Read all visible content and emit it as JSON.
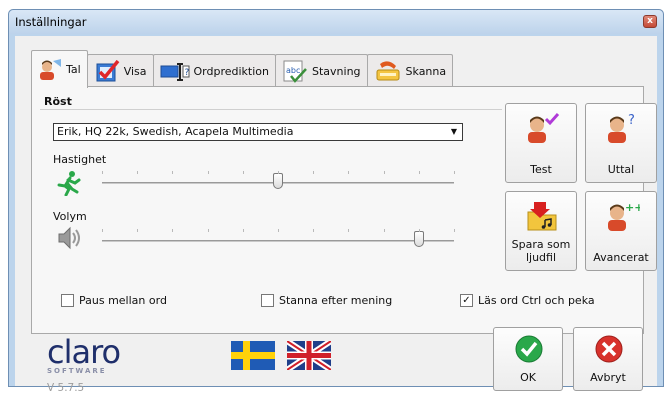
{
  "window": {
    "title": "Inställningar",
    "close_glyph": "x"
  },
  "tabs": [
    {
      "label": "Tal",
      "icon": "speaker-person-icon",
      "active": true
    },
    {
      "label": "Visa",
      "icon": "check-document-icon",
      "active": false
    },
    {
      "label": "Ordprediktion",
      "icon": "prediction-icon",
      "active": false
    },
    {
      "label": "Stavning",
      "icon": "spelling-abc-icon",
      "active": false
    },
    {
      "label": "Skanna",
      "icon": "scanner-icon",
      "active": false
    }
  ],
  "voice": {
    "group_label": "Röst",
    "selected": "Erik, HQ 22k, Swedish, Acapela Multimedia",
    "speed_label": "Hastighet",
    "speed_value": 0.5,
    "volume_label": "Volym",
    "volume_value": 0.9
  },
  "buttons": {
    "test": "Test",
    "pronunciation": "Uttal",
    "save_audio": "Spara som ljudfil",
    "advanced": "Avancerat"
  },
  "checkboxes": [
    {
      "label": "Paus mellan ord",
      "checked": false
    },
    {
      "label": "Stanna efter mening",
      "checked": false
    },
    {
      "label": "Läs ord Ctrl och peka",
      "checked": true
    }
  ],
  "footer": {
    "brand": "claro",
    "brand_sub": "SOFTWARE",
    "version": "V 5.7.5",
    "ok": "OK",
    "cancel": "Avbryt"
  },
  "colors": {
    "accent_green": "#2aa84a",
    "cancel_red": "#d8322c",
    "brand_blue": "#1f2f6b"
  }
}
